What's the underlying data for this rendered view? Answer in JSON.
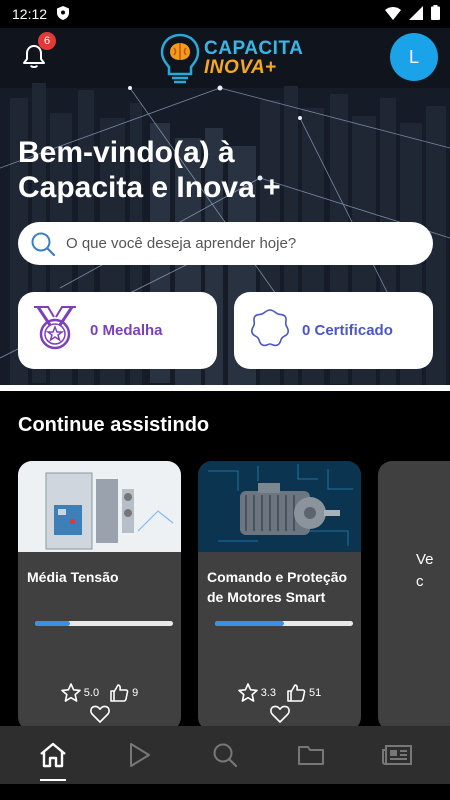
{
  "status_bar": {
    "time": "12:12"
  },
  "header": {
    "notification_count": "6",
    "logo_line1": "CAPACITA",
    "logo_line2": "INOVA",
    "logo_plus": "+",
    "avatar_initial": "L"
  },
  "hero": {
    "welcome_line1": "Bem-vindo(a) à",
    "welcome_line2": "Capacita e Inova +"
  },
  "search": {
    "placeholder": "O que você deseja aprender hoje?"
  },
  "achievements": {
    "medals_label": "0 Medalha",
    "certificates_label": "0 Certificado"
  },
  "continue_watching": {
    "title": "Continue assistindo",
    "courses": [
      {
        "title": "Média Tensão",
        "rating": "5.0",
        "likes": "9",
        "progress": 0.25
      },
      {
        "title": "Comando e Proteção de Motores Smart",
        "rating": "3.3",
        "likes": "51",
        "progress": 0.5
      }
    ],
    "partial_card_text_line1": "Ve",
    "partial_card_text_line2": "c"
  },
  "bottom_nav": {
    "items": [
      "home-icon",
      "play-icon",
      "search-icon",
      "folder-icon",
      "newspaper-icon"
    ],
    "active": "home-icon"
  },
  "colors": {
    "accent_blue": "#1aa3e8",
    "medal_purple": "#7b3fbf",
    "cert_blue": "#4a56c8",
    "card_bg": "#404040",
    "badge_red": "#e53935"
  }
}
